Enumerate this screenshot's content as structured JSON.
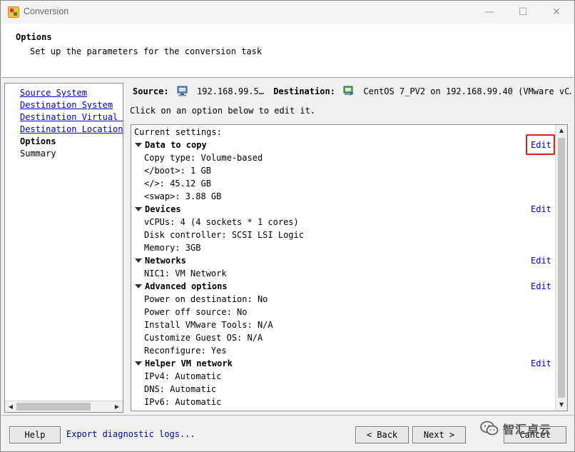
{
  "window": {
    "title": "Conversion",
    "minimize_glyph": "—",
    "maximize_glyph": "☐",
    "close_glyph": "✕",
    "app_icon": "converter-app-icon"
  },
  "header": {
    "title": "Options",
    "subtitle": "Set up the parameters for the conversion task"
  },
  "nav": {
    "items": [
      {
        "label": "Source System"
      },
      {
        "label": "Destination System"
      },
      {
        "label": "Destination Virtual M"
      },
      {
        "label": "Destination Location"
      },
      {
        "label": "Options"
      },
      {
        "label": "Summary"
      }
    ]
  },
  "source": {
    "label": "Source:",
    "value": "192.168.99.5…",
    "icon": "physical-machine-icon"
  },
  "destination": {
    "label": "Destination:",
    "value": "CentOS 7_PV2 on 192.168.99.40 (VMware vC…",
    "icon": "virtual-machine-icon"
  },
  "instruction": "Click on an option below to edit it.",
  "settings": {
    "current_label": "Current settings:",
    "edit_label": "Edit",
    "sections": [
      {
        "title": "Data to copy",
        "items": [
          "Copy type: Volume-based",
          "</boot>: 1 GB",
          "</>: 45.12 GB",
          "<swap>: 3.88 GB"
        ]
      },
      {
        "title": "Devices",
        "items": [
          "vCPUs: 4 (4 sockets * 1 cores)",
          "Disk controller: SCSI LSI Logic",
          "Memory: 3GB"
        ]
      },
      {
        "title": "Networks",
        "items": [
          "NIC1: VM Network"
        ]
      },
      {
        "title": "Advanced options",
        "items": [
          "Power on destination: No",
          "Power off source: No",
          "Install VMware Tools: N/A",
          "Customize Guest OS: N/A",
          "Reconfigure: Yes"
        ]
      },
      {
        "title": "Helper VM network",
        "items": [
          "IPv4: Automatic",
          "DNS: Automatic",
          "IPv6: Automatic"
        ]
      }
    ]
  },
  "footer": {
    "help": "Help",
    "diagnostic": "Export diagnostic logs...",
    "back": "< Back",
    "next": "Next >",
    "cancel": "Cancel"
  },
  "watermark": {
    "text": "智汇卓云",
    "icon": "wechat-icon"
  },
  "colors": {
    "link": "#0000cc",
    "highlight": "#e0201c"
  }
}
